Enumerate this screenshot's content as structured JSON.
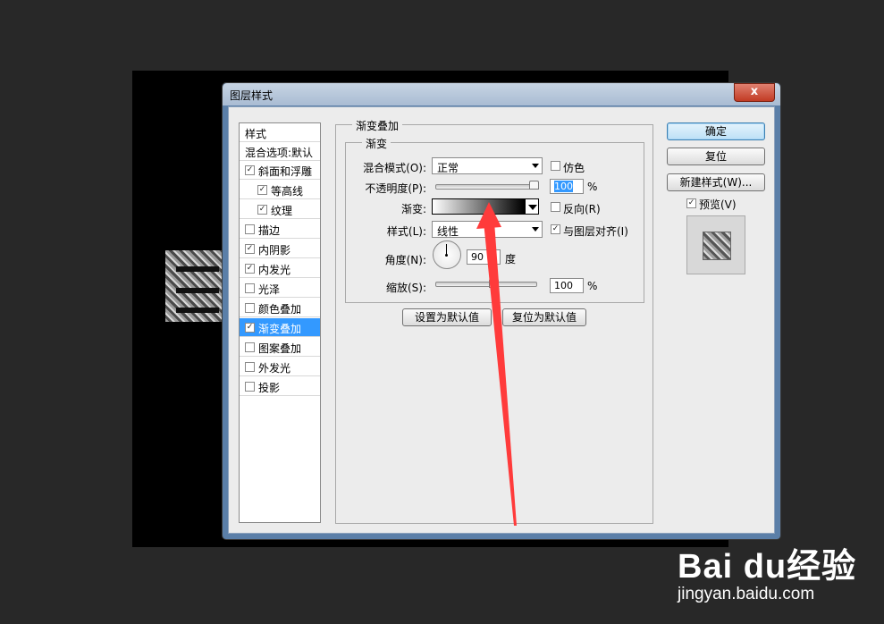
{
  "dialog": {
    "title": "图层样式",
    "close_label": "x"
  },
  "style_list": {
    "header": "样式",
    "blend_options": "混合选项:默认",
    "items": [
      {
        "label": "斜面和浮雕",
        "checked": true,
        "indent": false
      },
      {
        "label": "等高线",
        "checked": true,
        "indent": true
      },
      {
        "label": "纹理",
        "checked": true,
        "indent": true
      },
      {
        "label": "描边",
        "checked": false,
        "indent": false
      },
      {
        "label": "内阴影",
        "checked": true,
        "indent": false
      },
      {
        "label": "内发光",
        "checked": true,
        "indent": false
      },
      {
        "label": "光泽",
        "checked": false,
        "indent": false
      },
      {
        "label": "颜色叠加",
        "checked": false,
        "indent": false
      },
      {
        "label": "渐变叠加",
        "checked": true,
        "indent": false,
        "selected": true
      },
      {
        "label": "图案叠加",
        "checked": false,
        "indent": false
      },
      {
        "label": "外发光",
        "checked": false,
        "indent": false
      },
      {
        "label": "投影",
        "checked": false,
        "indent": false
      }
    ]
  },
  "panel": {
    "outer_title": "渐变叠加",
    "inner_title": "渐变",
    "blend_mode_label": "混合模式(O):",
    "blend_mode_value": "正常",
    "dither_label": "仿色",
    "opacity_label": "不透明度(P):",
    "opacity_value": "100",
    "opacity_unit": "%",
    "gradient_label": "渐变:",
    "reverse_label": "反向(R)",
    "style_label": "样式(L):",
    "style_value": "线性",
    "align_label": "与图层对齐(I)",
    "angle_label": "角度(N):",
    "angle_value": "90",
    "angle_unit": "度",
    "scale_label": "缩放(S):",
    "scale_value": "100",
    "scale_unit": "%",
    "make_default": "设置为默认值",
    "reset_default": "复位为默认值"
  },
  "buttons": {
    "ok": "确定",
    "reset": "复位",
    "new_style": "新建样式(W)...",
    "preview": "预览(V)"
  },
  "watermark": {
    "brand": "Bai du经验",
    "url": "jingyan.baidu.com"
  },
  "colors": {
    "selected": "#3399ff",
    "arrow": "#ff3b3b"
  }
}
